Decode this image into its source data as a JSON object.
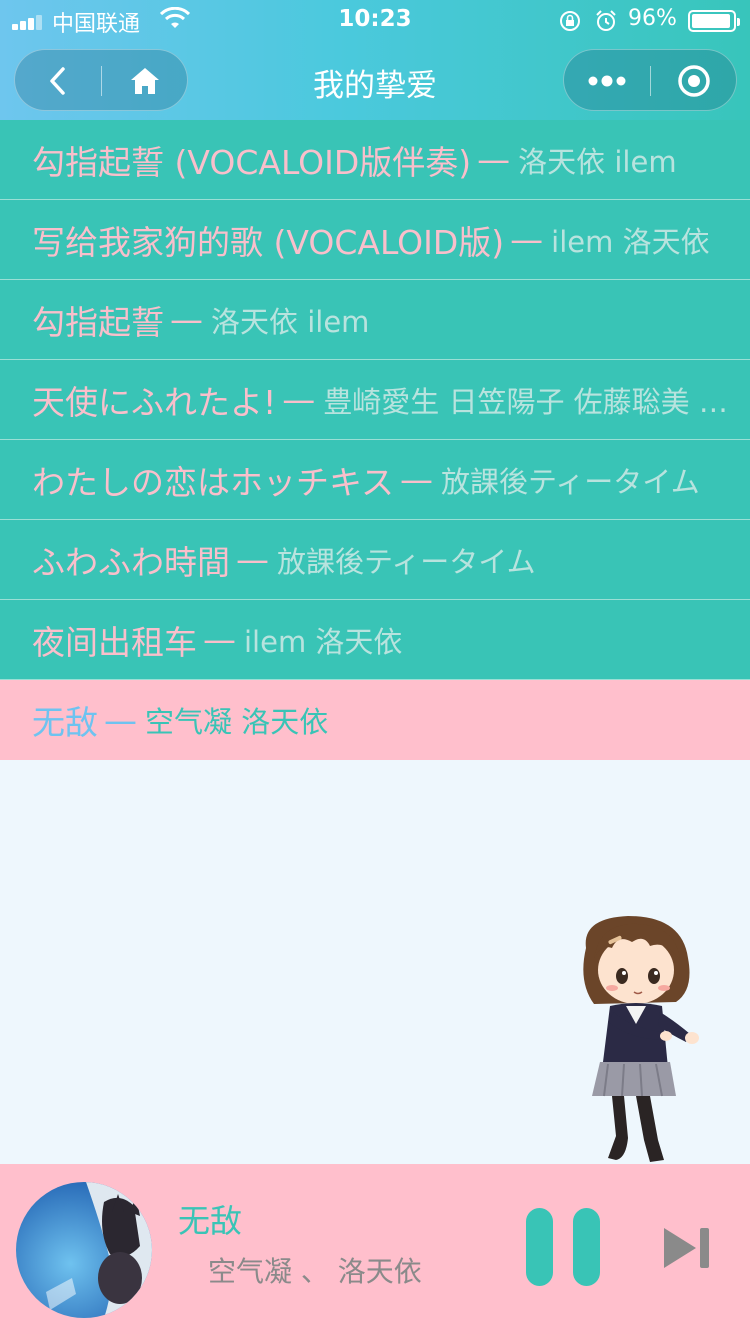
{
  "status_bar": {
    "carrier": "中国联通",
    "time": "10:23",
    "battery_percent": "96%",
    "battery_level": 0.96
  },
  "nav": {
    "title": "我的挚爱",
    "back_icon": "chevron-left-icon",
    "home_icon": "home-icon",
    "more_icon": "more-dots-icon",
    "close_icon": "target-close-icon"
  },
  "songs": [
    {
      "title": "勾指起誓 (VOCALOID版伴奏)",
      "dash": "—",
      "artist": "洛天依 ilem",
      "active": false
    },
    {
      "title": "写给我家狗的歌 (VOCALOID版)",
      "dash": "—",
      "artist": "ilem 洛天依",
      "active": false
    },
    {
      "title": "勾指起誓",
      "dash": "—",
      "artist": "洛天依 ilem",
      "active": false
    },
    {
      "title": "天使にふれたよ!",
      "dash": "—",
      "artist": "豊崎愛生 日笠陽子 佐藤聡美 寿美菜子",
      "active": false
    },
    {
      "title": "わたしの恋はホッチキス",
      "dash": "—",
      "artist": "放課後ティータイム",
      "active": false
    },
    {
      "title": "ふわふわ時間",
      "dash": "—",
      "artist": "放課後ティータイム",
      "active": false
    },
    {
      "title": "夜间出租车",
      "dash": "—",
      "artist": "ilem 洛天依",
      "active": false
    },
    {
      "title": "无敌",
      "dash": "—",
      "artist": "空气凝 洛天依",
      "active": true
    }
  ],
  "player": {
    "title": "无敌",
    "artist": "空气凝 、 洛天依",
    "play_state": "playing"
  },
  "colors": {
    "teal": "#39c4b6",
    "pink": "#ffbfcc",
    "title_pink": "#f9bfcb",
    "active_blue": "#6ec3f0",
    "background": "#eef7fd"
  }
}
